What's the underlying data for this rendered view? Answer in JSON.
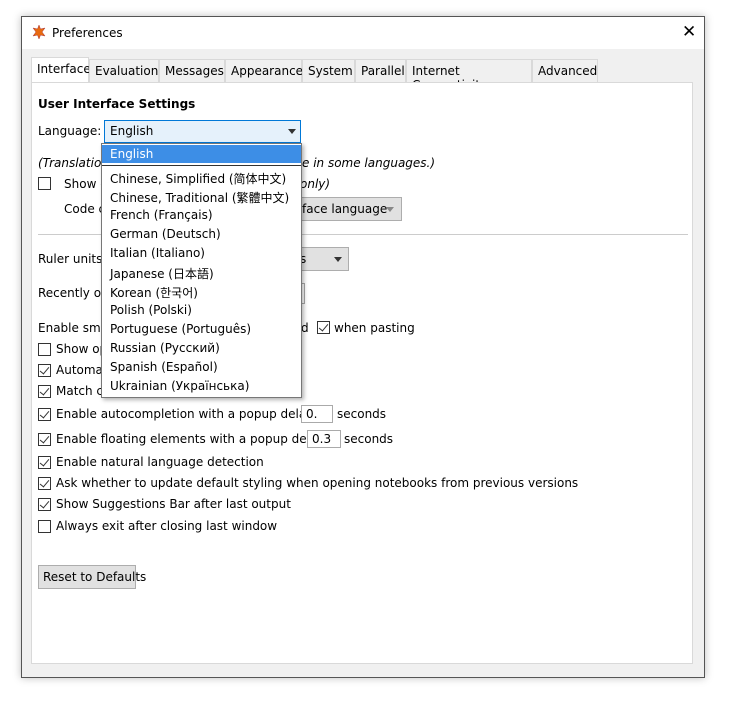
{
  "window": {
    "title": "Preferences",
    "close_icon": "close-icon",
    "app_icon": "wolfram-star-icon"
  },
  "tabs": [
    "Interface",
    "Evaluation",
    "Messages",
    "Appearance",
    "System",
    "Parallel",
    "Internet Connectivity",
    "Advanced"
  ],
  "active_tab": "Interface",
  "section_title": "User Interface Settings",
  "language": {
    "label": "Language:",
    "value": "English",
    "options": [
      "English",
      "Chinese, Simplified (简体中文)",
      "Chinese, Traditional (繁體中文)",
      "French (Français)",
      "German (Deutsch)",
      "Italian (Italiano)",
      "Japanese (日本語)",
      "Korean (한국어)",
      "Polish (Polski)",
      "Portuguese (Português)",
      "Russian (Русский)",
      "Spanish (Español)",
      "Ukrainian (Українська)"
    ]
  },
  "partial": {
    "translation_left": "(Translation",
    "translation_right": "e in some languages.)",
    "show_left": "Show c",
    "show_right": "only)",
    "code_left": "Code c",
    "code_value": "face language",
    "ruler_label": "Ruler units:",
    "ruler_value": "s",
    "recent_label": "Recently op",
    "smart_left": "Enable smar",
    "smart_right": "d",
    "show_op": "Show op",
    "automat": "Automat",
    "match": "Match ca"
  },
  "when_pasting": "when pasting",
  "autocompletion": {
    "label": "Enable autocompletion with a popup delay of",
    "value": "0.",
    "unit": "seconds"
  },
  "floating": {
    "label": "Enable floating elements with a popup delay of",
    "value": "0.3",
    "unit": "seconds"
  },
  "checks": [
    {
      "label": "Enable natural language detection",
      "checked": true
    },
    {
      "label": "Ask whether to update default styling when opening notebooks from previous versions",
      "checked": true
    },
    {
      "label": "Show Suggestions Bar after last output",
      "checked": true
    },
    {
      "label": "Always exit after closing last window",
      "checked": false
    }
  ],
  "reset_button": "Reset to Defaults",
  "colors": {
    "highlight": "#3d8ee6",
    "combo_focus": "#0078d7"
  }
}
